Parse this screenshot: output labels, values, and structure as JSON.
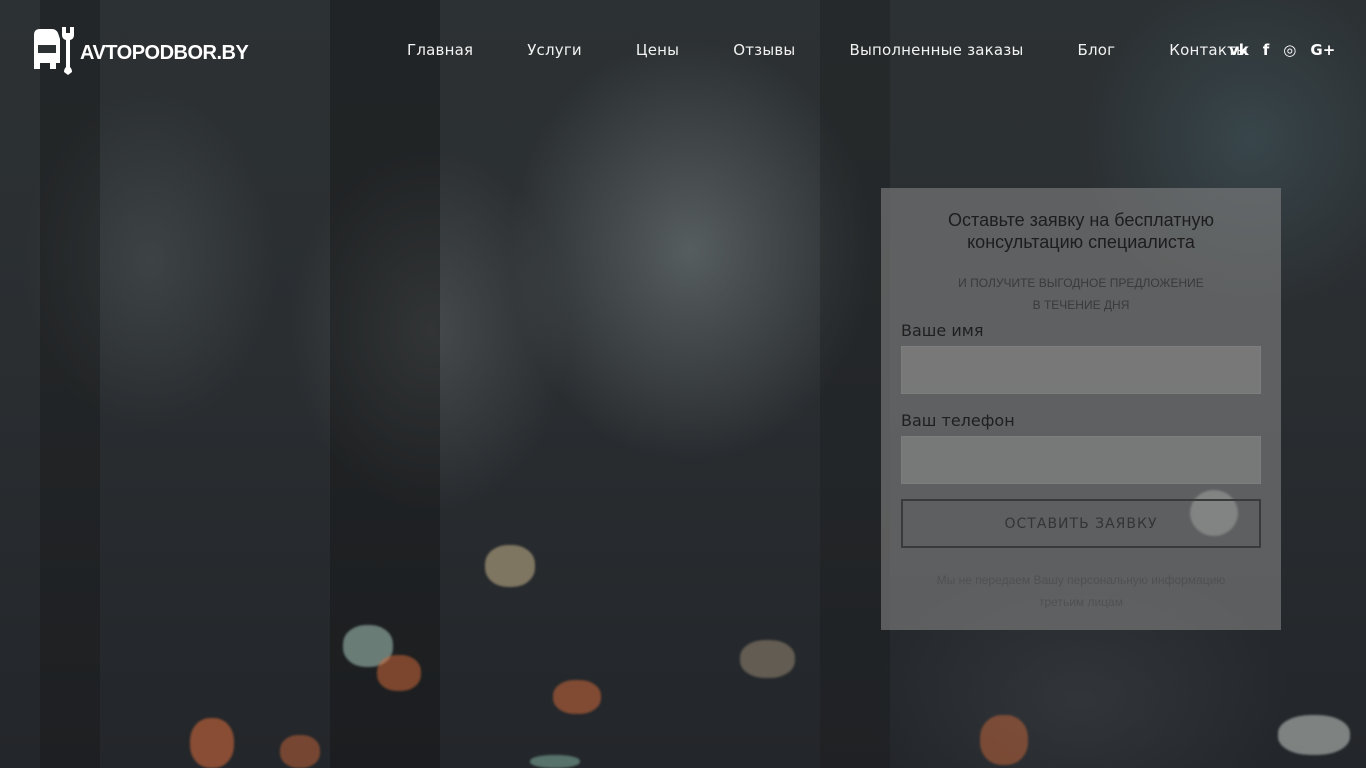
{
  "header": {
    "logo_text": "AVTOPODBOR.BY",
    "nav": [
      {
        "label": "Главная"
      },
      {
        "label": "Услуги"
      },
      {
        "label": "Цены"
      },
      {
        "label": "Отзывы"
      },
      {
        "label": "Выполненные заказы"
      },
      {
        "label": "Блог"
      },
      {
        "label": "Контакты"
      }
    ],
    "social": [
      {
        "icon": "vk-icon",
        "glyph": "vk"
      },
      {
        "icon": "facebook-icon",
        "glyph": "f"
      },
      {
        "icon": "instagram-icon",
        "glyph": "◎"
      },
      {
        "icon": "google-plus-icon",
        "glyph": "G+"
      }
    ]
  },
  "form": {
    "title_line1": "Оставьте заявку на бесплатную",
    "title_line2": "консультацию специалиста",
    "subtitle_line1": "И ПОЛУЧИТЕ ВЫГОДНОЕ ПРЕДЛОЖЕНИЕ",
    "subtitle_line2": "В ТЕЧЕНИЕ ДНЯ",
    "name_label": "Ваше имя",
    "name_value": "",
    "phone_label": "Ваш телефон",
    "phone_value": "",
    "submit_label": "ОСТАВИТЬ ЗАЯВКУ",
    "privacy_line1": "Мы не передаем Вашу персональную информацию",
    "privacy_line2": "третьим лицам"
  }
}
